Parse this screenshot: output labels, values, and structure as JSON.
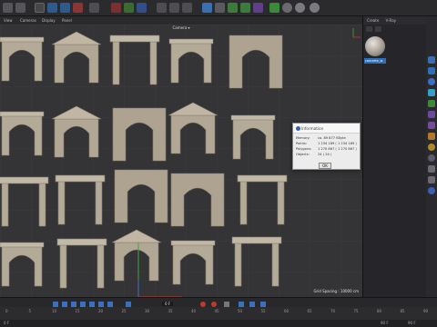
{
  "menubar": {
    "items": [
      "View",
      "Cameras",
      "Display",
      "Panel"
    ]
  },
  "viewport": {
    "camera_label": "Camera ▾",
    "grid_spacing": "Grid Spacing : 10000 cm"
  },
  "object_manager": {
    "tabs": [
      "Create",
      "V-Ray"
    ],
    "material_name": "concrete_w"
  },
  "info_dialog": {
    "title": "Information",
    "rows": [
      {
        "label": "Memory:",
        "value": "ca. 89 877 KByte"
      },
      {
        "label": "Points:",
        "value": "1 234 189 ( 1 234 189 )"
      },
      {
        "label": "Polygons:",
        "value": "1 270 867 ( 1 270 867 )"
      },
      {
        "label": "Objects:",
        "value": "24 ( 24 )"
      }
    ],
    "ok_label": "OK"
  },
  "timeline": {
    "current_frame": "0 F",
    "ruler_labels": [
      "0",
      "5",
      "10",
      "15",
      "20",
      "25",
      "30",
      "35",
      "40",
      "45",
      "50",
      "55",
      "60",
      "65",
      "70",
      "75",
      "80",
      "85",
      "90"
    ],
    "start_frame": "0 F",
    "end_frame": "90 F",
    "min_frame": "90 F"
  },
  "colors": {
    "accent_blue": "#2f6fb5",
    "arch_stone": "#b4aa98"
  }
}
